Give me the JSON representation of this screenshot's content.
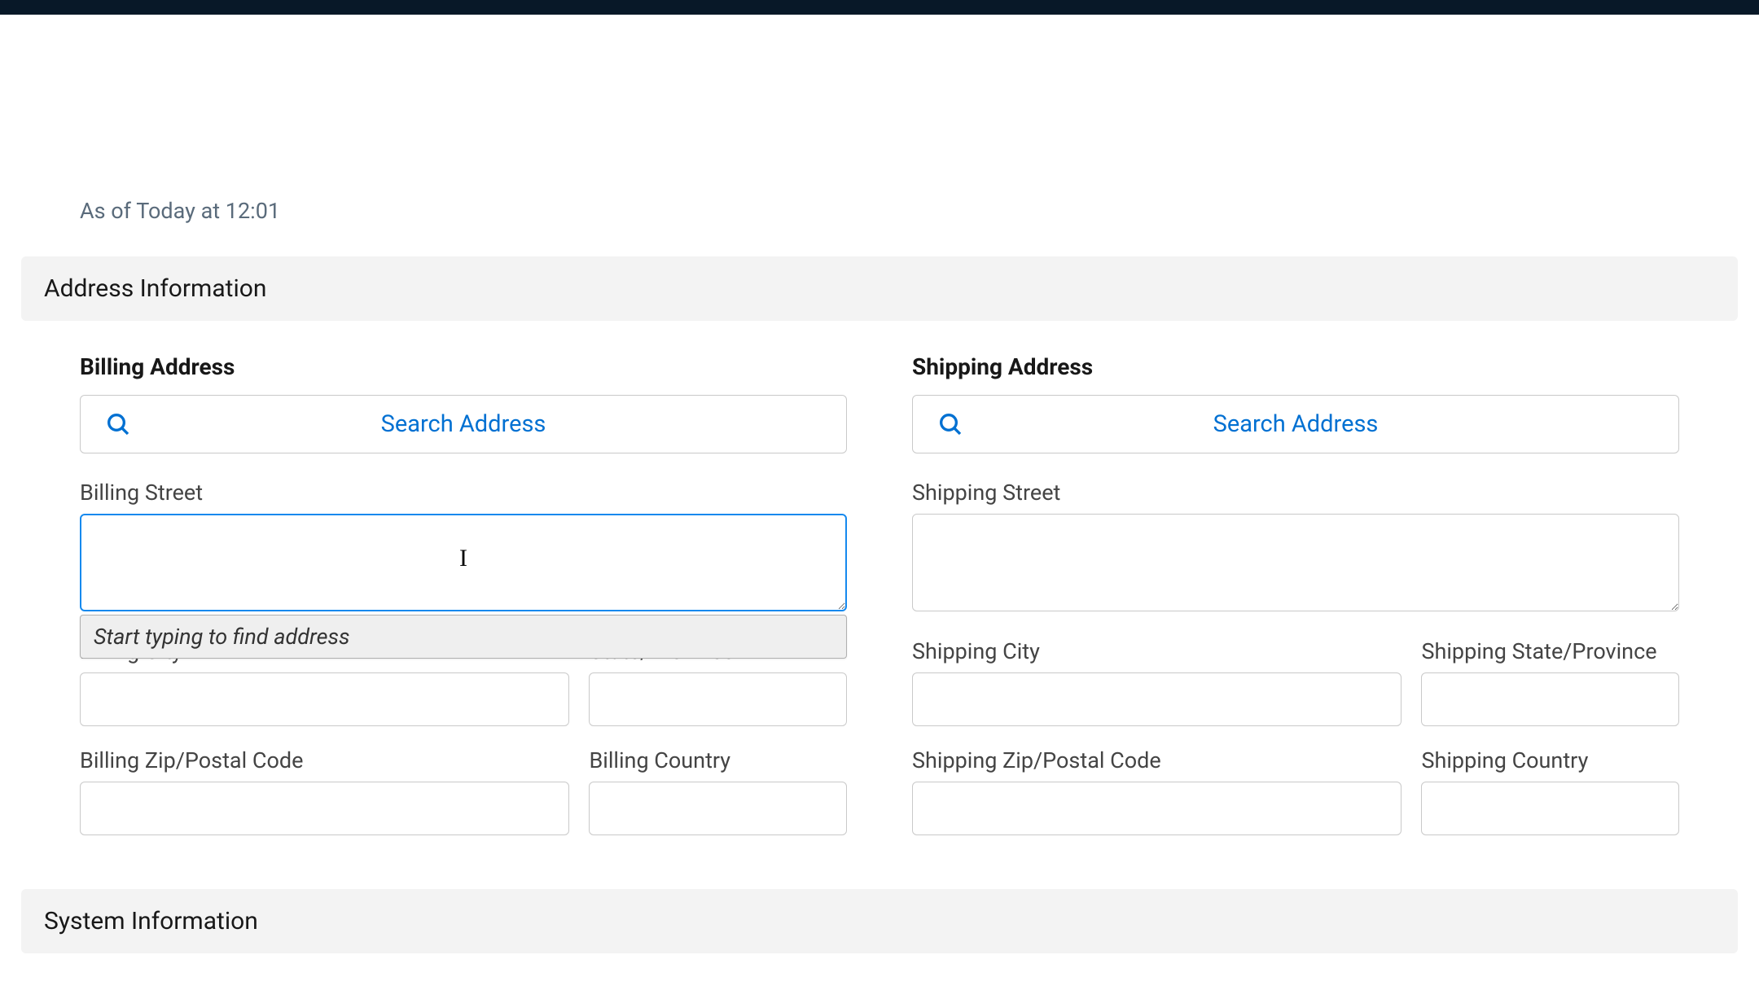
{
  "timestamp": "As of Today at 12:01",
  "sections": {
    "address": {
      "title": "Address Information",
      "billing": {
        "group_label": "Billing Address",
        "search_button": "Search Address",
        "street_label": "Billing Street",
        "street_value": "",
        "autocomplete_hint": "Start typing to find address",
        "city_label": "Billing City",
        "city_value": "",
        "state_label": "State/Province",
        "state_value": "",
        "zip_label": "Billing Zip/Postal Code",
        "zip_value": "",
        "country_label": "Billing Country",
        "country_value": ""
      },
      "shipping": {
        "group_label": "Shipping Address",
        "search_button": "Search Address",
        "street_label": "Shipping Street",
        "street_value": "",
        "city_label": "Shipping City",
        "city_value": "",
        "state_label": "Shipping State/Province",
        "state_value": "",
        "zip_label": "Shipping Zip/Postal Code",
        "zip_value": "",
        "country_label": "Shipping Country",
        "country_value": ""
      }
    },
    "system": {
      "title": "System Information"
    }
  },
  "colors": {
    "link": "#0070d2",
    "focus_ring": "#1589ee",
    "section_bg": "#f3f3f3",
    "top_bar": "#081828"
  },
  "icons": {
    "search": "search-icon"
  }
}
